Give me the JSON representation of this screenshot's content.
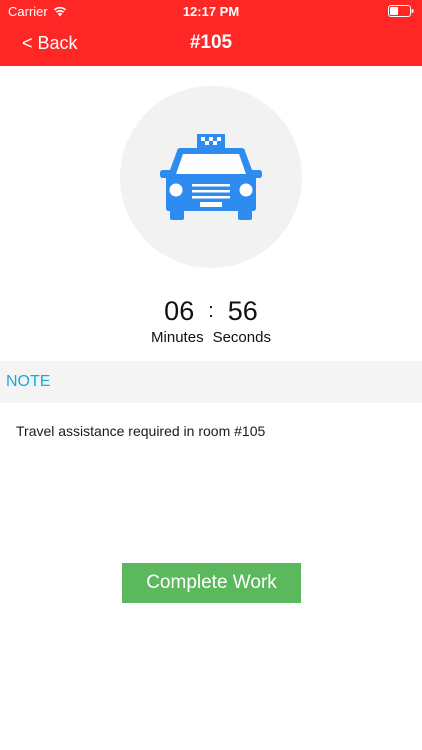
{
  "status_bar": {
    "carrier": "Carrier",
    "time": "12:17 PM",
    "wifi_icon": "wifi-icon",
    "battery_icon": "battery-icon"
  },
  "nav": {
    "back_label": "< Back",
    "title": "#105"
  },
  "service": {
    "icon": "taxi-icon",
    "icon_color": "#2e8bf0"
  },
  "timer": {
    "minutes": "06",
    "separator": ":",
    "seconds": "56",
    "minutes_label": "Minutes",
    "seconds_label": "Seconds"
  },
  "note": {
    "heading": "NOTE",
    "text": "Travel assistance required in room #105"
  },
  "actions": {
    "complete_label": "Complete Work"
  },
  "colors": {
    "header": "#ff2626",
    "accent": "#1aa8dc",
    "complete_button": "#5cb85c"
  }
}
